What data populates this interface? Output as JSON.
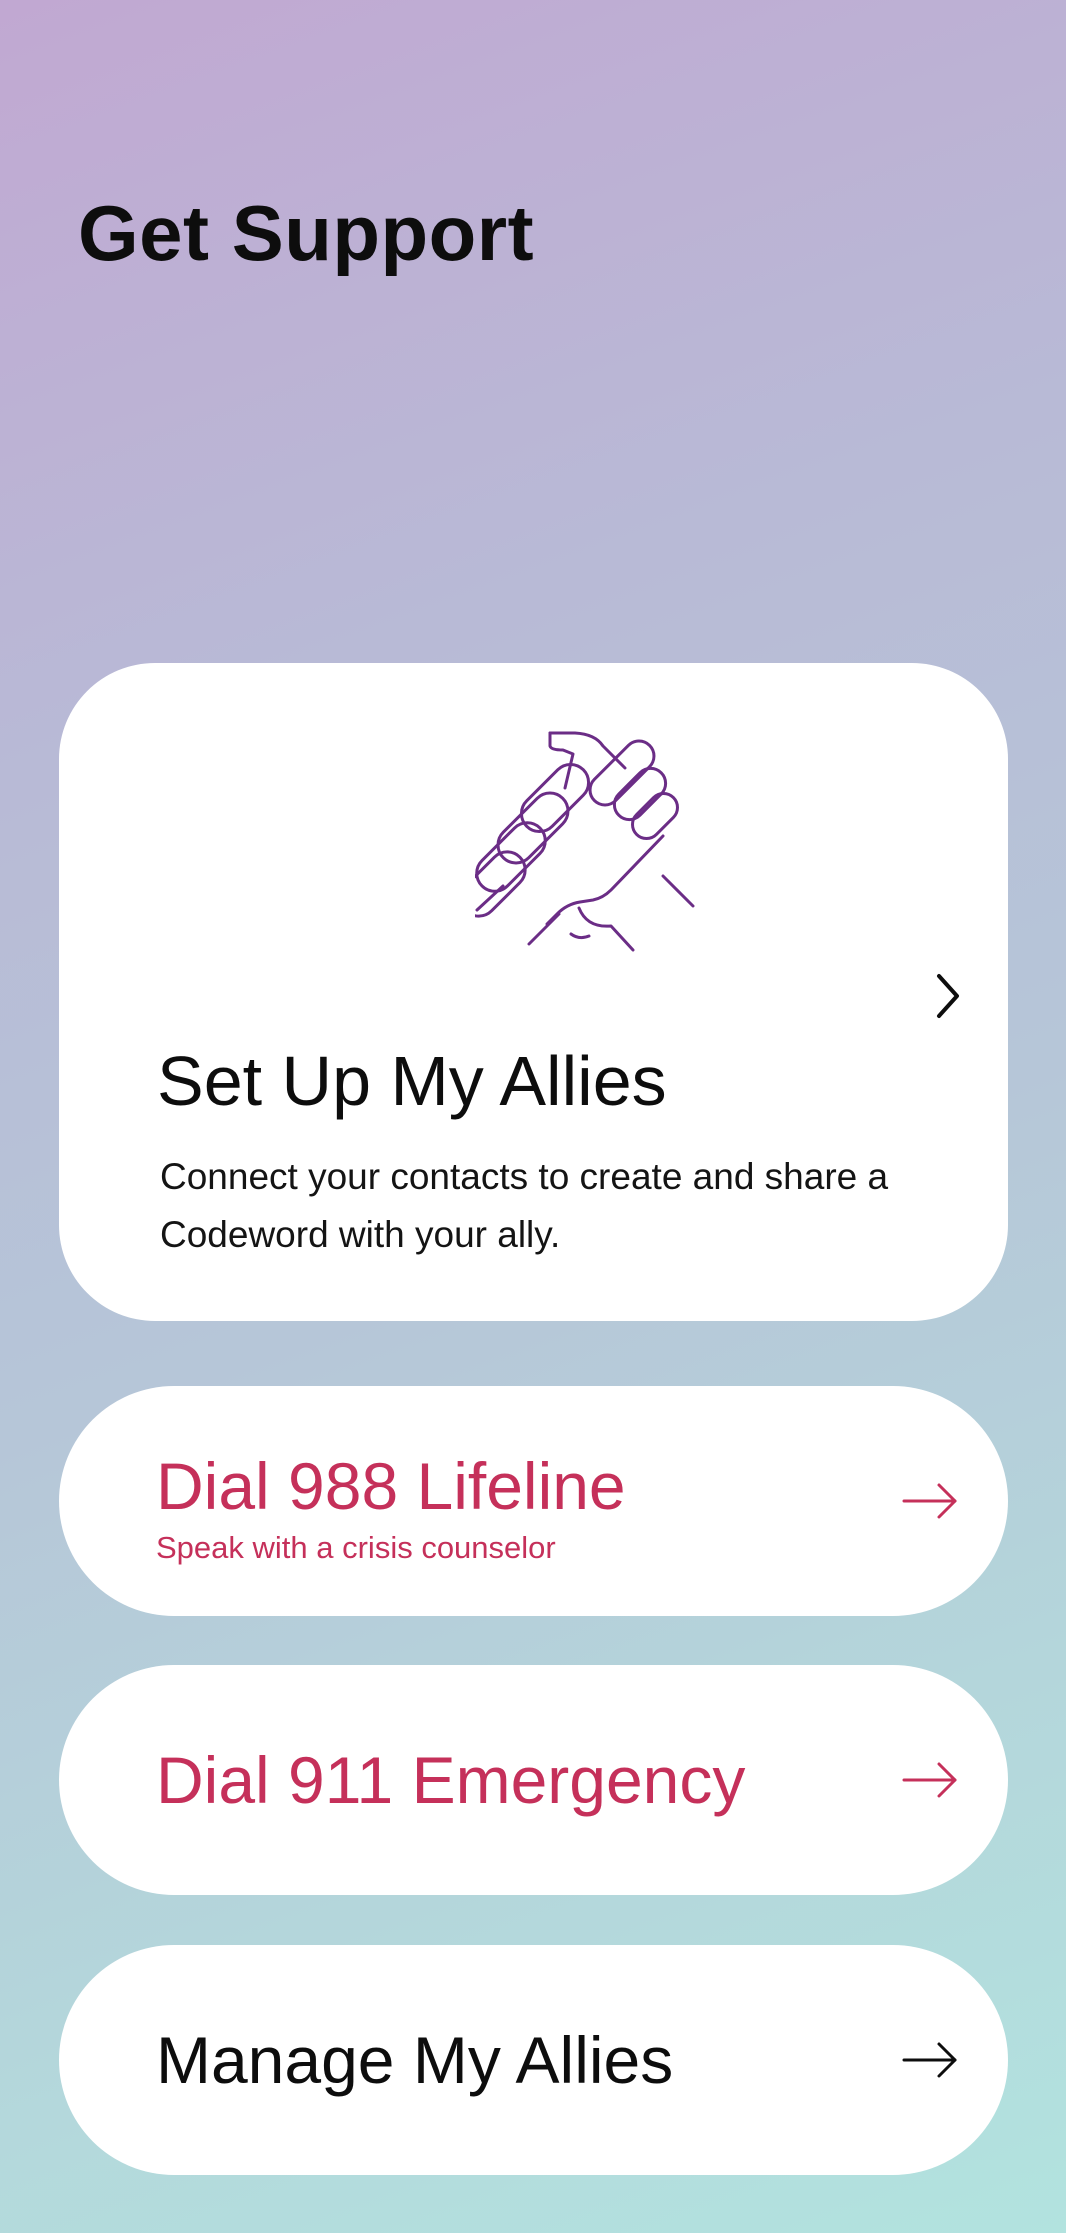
{
  "page": {
    "title": "Get Support"
  },
  "allies_card": {
    "icon": "clasped-hands-icon",
    "title": "Set Up My Allies",
    "description": "Connect your contacts to create and share a Codeword with your ally.",
    "chevron_icon": "chevron-right-icon"
  },
  "lifeline": {
    "title": "Dial 988 Lifeline",
    "subtitle": "Speak with a crisis counselor",
    "icon": "arrow-right-icon"
  },
  "emergency": {
    "title": "Dial 911 Emergency",
    "icon": "arrow-right-icon"
  },
  "manage": {
    "title": "Manage My Allies",
    "icon": "arrow-right-icon"
  },
  "colors": {
    "accent_red": "#c5305a",
    "icon_purple": "#6b2d86",
    "text_dark": "#0d0d0d",
    "gradient_top": "#c1a8d2",
    "gradient_bottom": "#b2e3df",
    "card_bg": "#ffffff"
  }
}
